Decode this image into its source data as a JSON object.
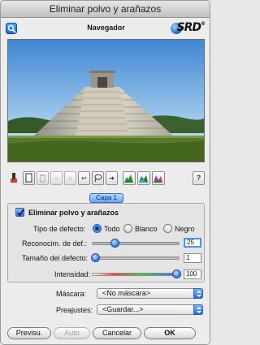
{
  "window": {
    "title": "Eliminar polvo y arañazos"
  },
  "navigator": {
    "title": "Navegador",
    "logo_text": "SRD",
    "logo_mark": "®"
  },
  "toolbar": {
    "buttons": [
      {
        "icon": "brush-icon",
        "glyph": ""
      },
      {
        "icon": "new-document-icon",
        "glyph": ""
      },
      {
        "icon": "trash-icon",
        "glyph": "🗑"
      },
      {
        "icon": "rewind-icon",
        "glyph": "«"
      },
      {
        "icon": "fast-forward-icon",
        "glyph": "»"
      },
      {
        "icon": "undo-icon",
        "glyph": "↩"
      },
      {
        "icon": "lasso-icon",
        "glyph": ""
      },
      {
        "icon": "arrow-right-icon",
        "glyph": "➜"
      },
      {
        "icon": "histogram-icon",
        "glyph": ""
      },
      {
        "icon": "histogram-green-icon",
        "glyph": ""
      },
      {
        "icon": "histogram-magenta-icon",
        "glyph": ""
      },
      {
        "icon": "help-icon",
        "glyph": "?"
      }
    ]
  },
  "layer_tab": {
    "label": "Capa 1"
  },
  "panel": {
    "enable_label": "Eliminar polvo y arañazos",
    "defect_type": {
      "label": "Tipo de defecto:",
      "options": [
        "Todo",
        "Blanco",
        "Negro"
      ],
      "selected": "Todo"
    },
    "sliders": [
      {
        "label": "Reconocim. de def.:",
        "value": "25",
        "level": 0.25
      },
      {
        "label": "Tamaño del defecto:",
        "value": "1",
        "level": 0.01
      },
      {
        "label": "Intensidad:",
        "value": "100",
        "level": 1.0
      }
    ]
  },
  "mask": {
    "label": "Máscara:",
    "value": "<No máscara>"
  },
  "presets": {
    "label": "Preajustes:",
    "value": "<Guardar...>"
  },
  "buttons": {
    "preview": "Previsu.",
    "auto": "Auto",
    "cancel": "Cancelar",
    "ok": "OK"
  }
}
